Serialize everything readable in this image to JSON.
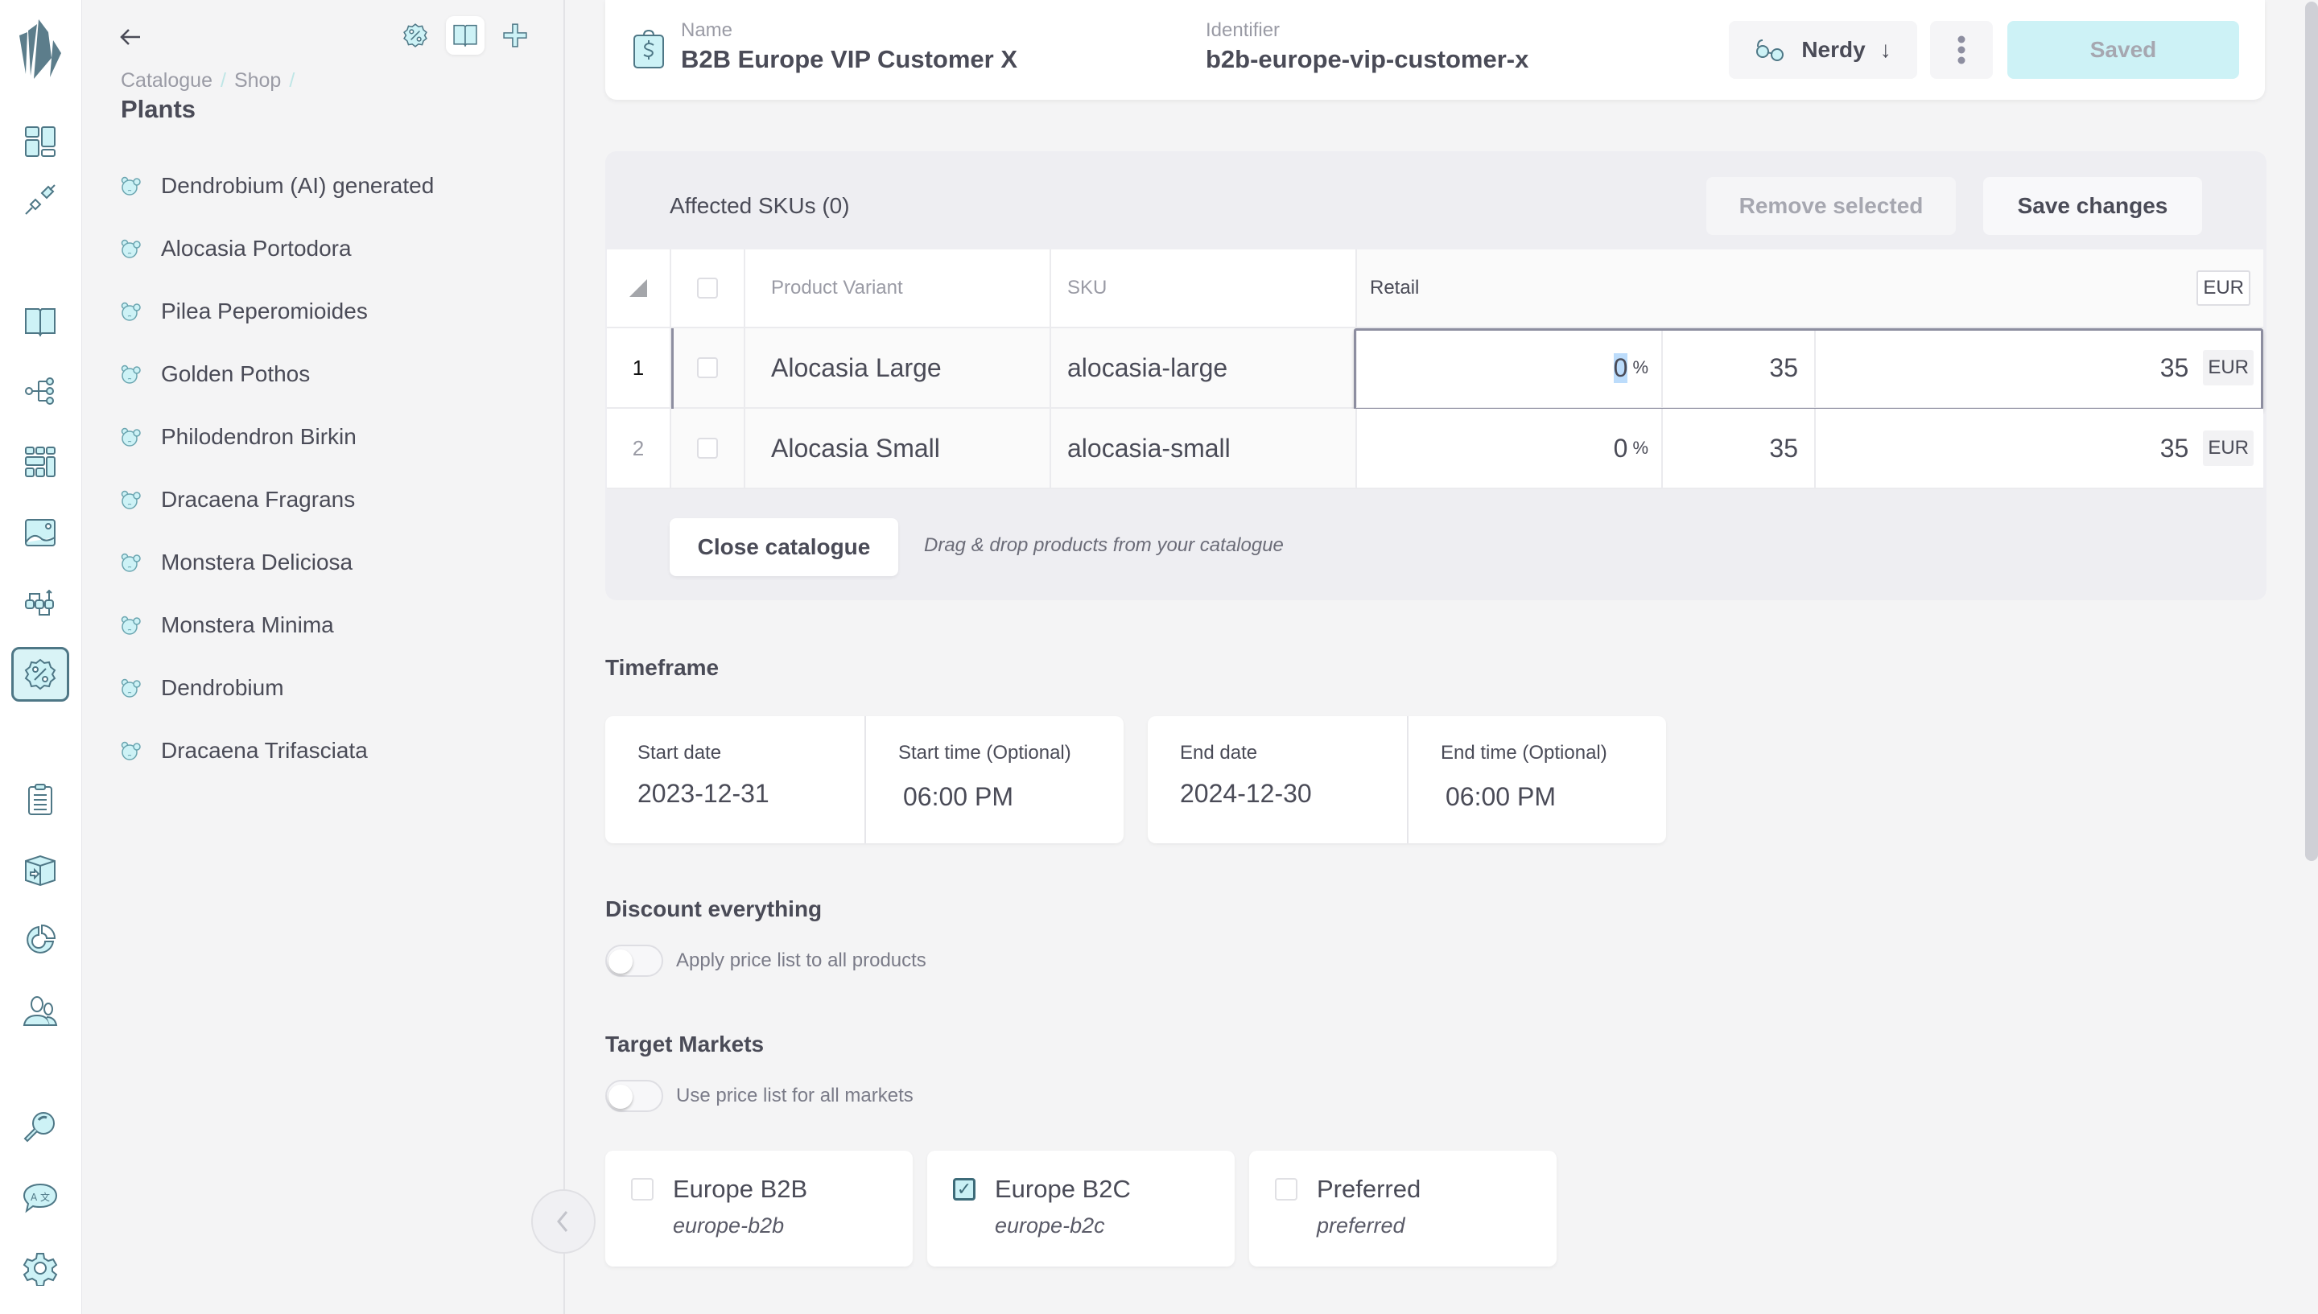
{
  "rail": {
    "logo": "crystal-logo",
    "items": [
      {
        "name": "dashboard",
        "icon": "dashboard-icon"
      },
      {
        "name": "plugins",
        "icon": "plug-icon"
      },
      {
        "name": "catalogue",
        "icon": "book-icon"
      },
      {
        "name": "topics",
        "icon": "hierarchy-icon"
      },
      {
        "name": "grid",
        "icon": "grid-icon"
      },
      {
        "name": "media",
        "icon": "image-icon"
      },
      {
        "name": "flows",
        "icon": "flow-icon"
      },
      {
        "name": "price-lists",
        "icon": "discount-icon",
        "active": true
      },
      {
        "name": "orders",
        "icon": "clipboard-icon"
      },
      {
        "name": "stock",
        "icon": "box-icon"
      },
      {
        "name": "reports",
        "icon": "pie-chart-icon"
      },
      {
        "name": "customers",
        "icon": "users-icon"
      },
      {
        "name": "search",
        "icon": "search-icon"
      },
      {
        "name": "translations",
        "icon": "translate-icon"
      },
      {
        "name": "settings",
        "icon": "gear-icon"
      }
    ]
  },
  "tree": {
    "breadcrumb": [
      "Catalogue",
      "Shop"
    ],
    "breadcrumb_separator": "/",
    "title": "Plants",
    "tools": [
      "discount-icon",
      "book-icon",
      "plus-icon"
    ],
    "items": [
      "Dendrobium (AI) generated",
      "Alocasia Portodora",
      "Pilea Peperomioides",
      "Golden Pothos",
      "Philodendron Birkin",
      "Dracaena Fragrans",
      "Monstera Deliciosa",
      "Monstera Minima",
      "Dendrobium",
      "Dracaena Trifasciata"
    ]
  },
  "header": {
    "name_label": "Name",
    "name_value": "B2B Europe VIP Customer X",
    "identifier_label": "Identifier",
    "identifier_value": "b2b-europe-vip-customer-x",
    "mode_label": "Nerdy",
    "mode_arrow": "↓",
    "saved_label": "Saved"
  },
  "skus": {
    "title": "Affected SKUs (0)",
    "remove_label": "Remove selected",
    "save_label": "Save changes",
    "columns": {
      "variant": "Product Variant",
      "sku": "SKU",
      "retail": "Retail",
      "currency": "EUR"
    },
    "rows": [
      {
        "index": "1",
        "variant": "Alocasia Large",
        "sku": "alocasia-large",
        "discount": "0",
        "unit": "%",
        "base": "35",
        "final": "35",
        "currency": "EUR"
      },
      {
        "index": "2",
        "variant": "Alocasia Small",
        "sku": "alocasia-small",
        "discount": "0",
        "unit": "%",
        "base": "35",
        "final": "35",
        "currency": "EUR"
      }
    ],
    "close_label": "Close catalogue",
    "drag_hint": "Drag & drop products from your catalogue"
  },
  "timeframe": {
    "title": "Timeframe",
    "start_date_label": "Start date",
    "start_date": "2023-12-31",
    "start_time_label": "Start time (Optional)",
    "start_time": "06:00 PM",
    "end_date_label": "End date",
    "end_date": "2024-12-30",
    "end_time_label": "End time (Optional)",
    "end_time": "06:00 PM"
  },
  "discount": {
    "title": "Discount everything",
    "toggle_label": "Apply price list to all products",
    "enabled": false
  },
  "markets": {
    "title": "Target Markets",
    "toggle_label": "Use price list for all markets",
    "enabled": false,
    "items": [
      {
        "name": "Europe B2B",
        "id": "europe-b2b",
        "checked": false
      },
      {
        "name": "Europe B2C",
        "id": "europe-b2c",
        "checked": true
      },
      {
        "name": "Preferred",
        "id": "preferred",
        "checked": false
      }
    ],
    "check_glyph": "✓"
  },
  "colors": {
    "accent": "#cdf2f6",
    "icon_stroke": "#4e7786",
    "text": "#4a4b57"
  }
}
